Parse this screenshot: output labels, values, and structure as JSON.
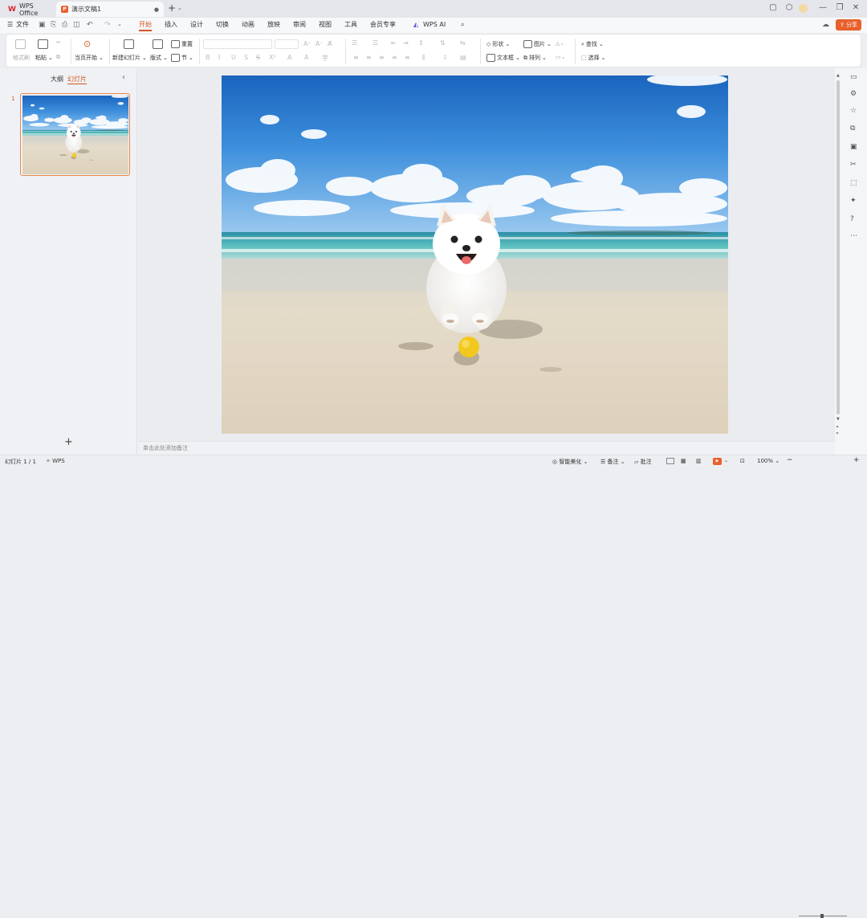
{
  "tabs": [
    {
      "label": "WPS Office"
    },
    {
      "label": "演示文稿1"
    }
  ],
  "share_label": "分享",
  "menu": {
    "file": "文件",
    "items": [
      "开始",
      "插入",
      "设计",
      "切换",
      "动画",
      "放映",
      "审阅",
      "视图",
      "工具",
      "会员专享"
    ],
    "ai": "WPS AI"
  },
  "ribbon": {
    "format_painter": "格式刷",
    "paste": "粘贴",
    "from_current": "当页开始",
    "new_slide": "新建幻灯片",
    "layout": "版式",
    "reset": "重置",
    "section": "节",
    "shape": "形状",
    "picture": "图片",
    "textbox": "文本框",
    "arrange": "排列",
    "find": "查找",
    "select": "选择",
    "font_btns": [
      "A⁺",
      "A⁻",
      "A̸"
    ],
    "style_btns": [
      "B",
      "I",
      "U",
      "S",
      "S",
      "X²",
      "A",
      "A",
      "字"
    ]
  },
  "left_pane": {
    "outline_tab": "大纲",
    "slides_tab": "幻灯片",
    "slide_number": "1",
    "add": "+"
  },
  "notes_placeholder": "单击此处添加备注",
  "status": {
    "slide_count": "幻灯片 1 / 1",
    "theme": "WPS",
    "beautify": "智能美化",
    "notes": "备注",
    "comments": "批注",
    "zoom": "100%"
  },
  "colors": {
    "accent": "#d35525",
    "share_bg": "#e8612c",
    "sky": "#1f71c6",
    "sand": "#e6dcc9",
    "sea": "#4fb3b5"
  }
}
